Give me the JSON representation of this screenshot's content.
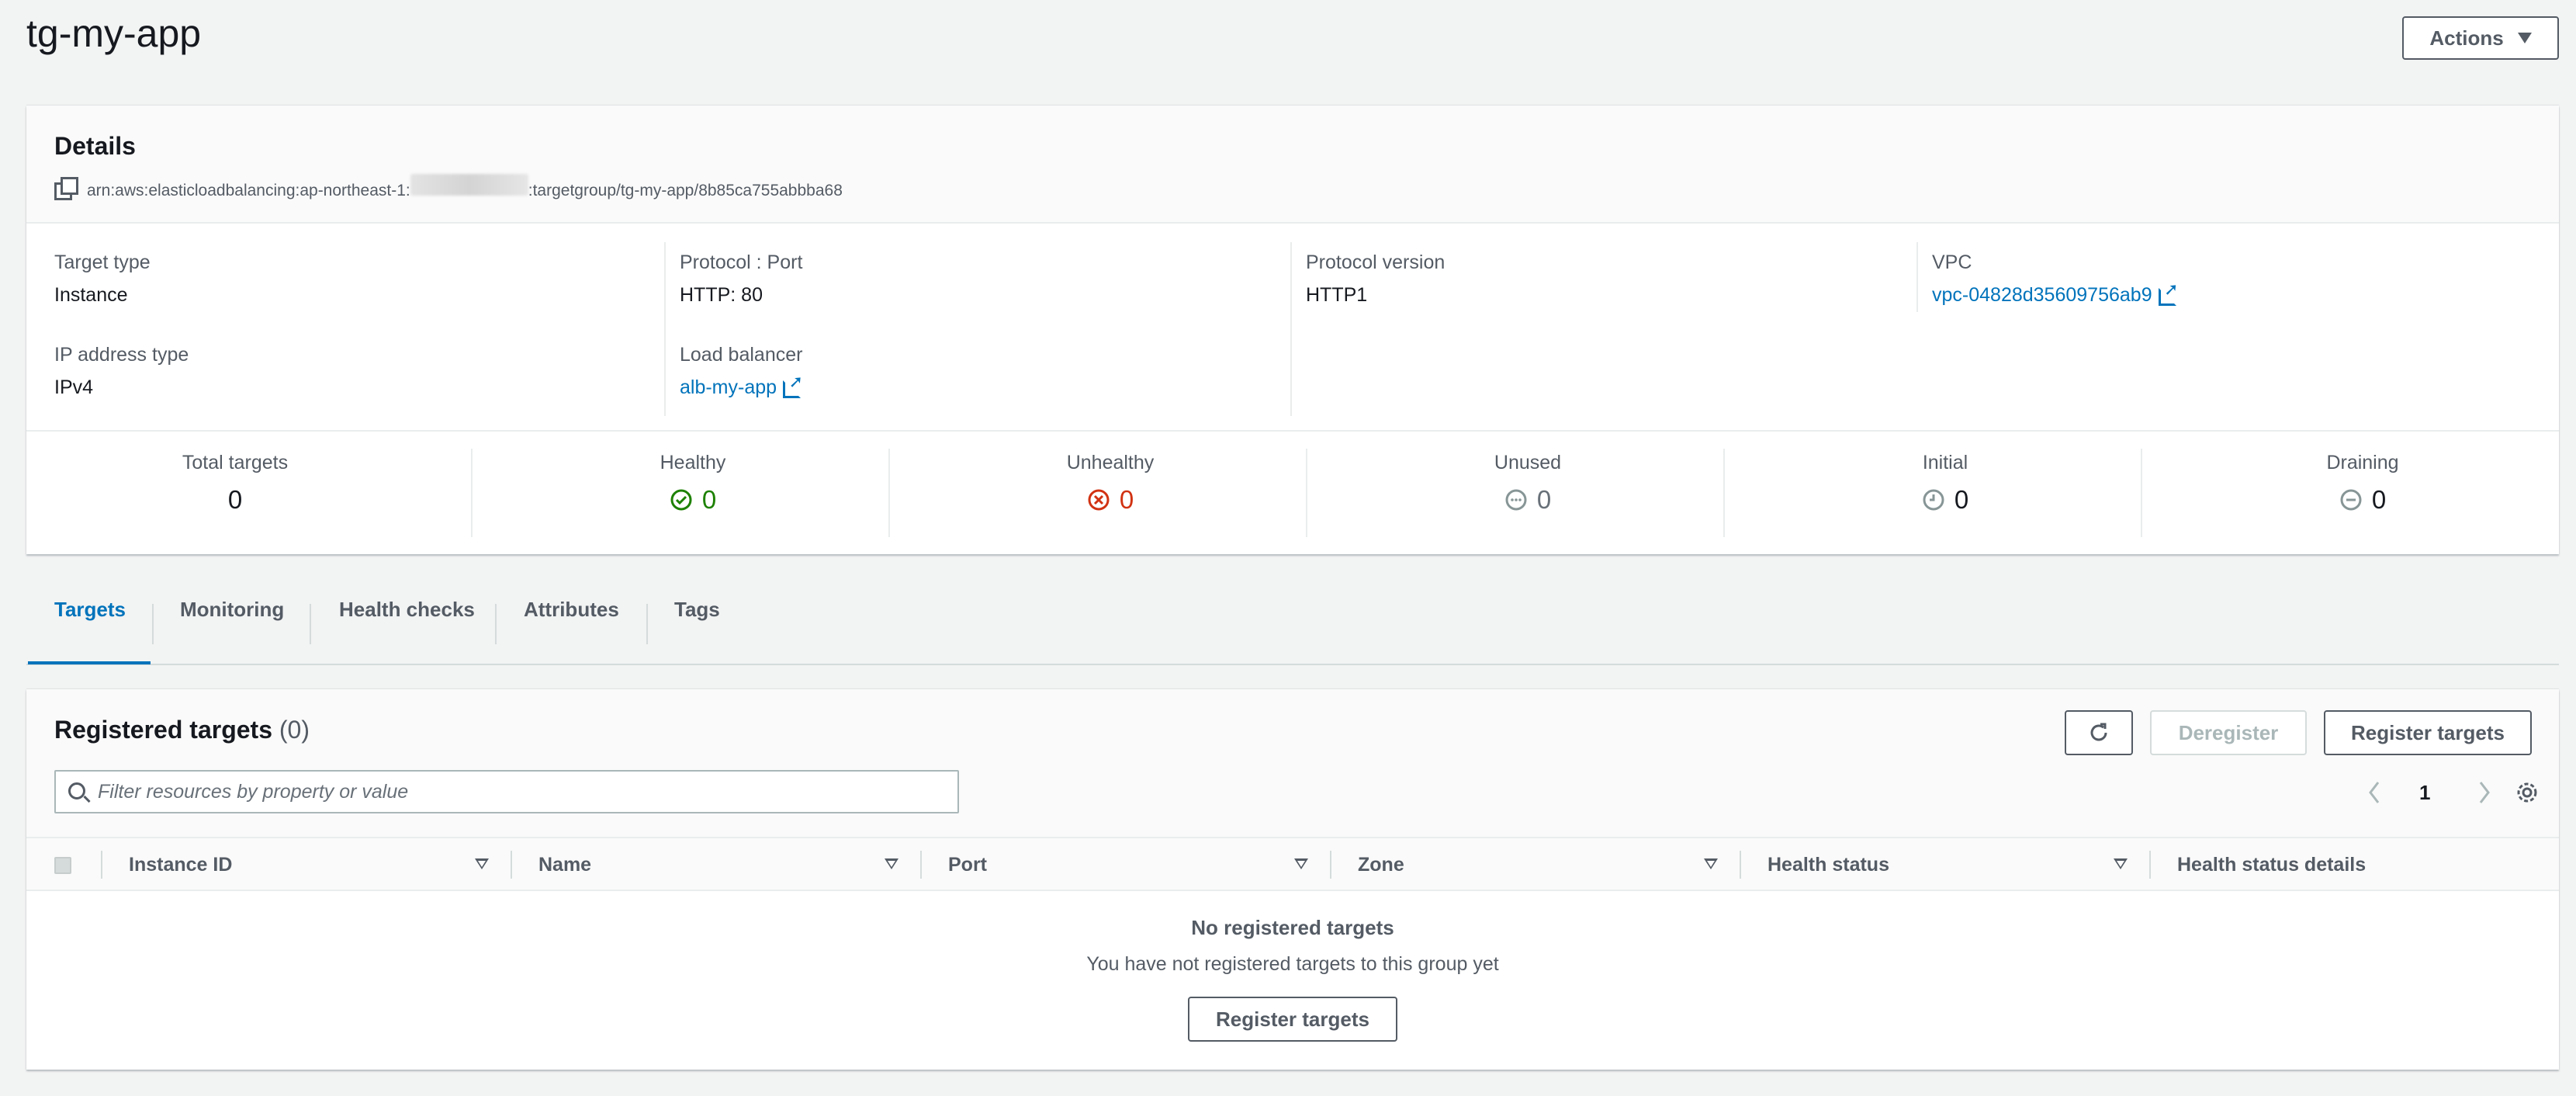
{
  "page": {
    "title": "tg-my-app",
    "actions_label": "Actions"
  },
  "details": {
    "title": "Details",
    "arn_prefix": "arn:aws:elasticloadbalancing:ap-northeast-1:",
    "arn_suffix": ":targetgroup/tg-my-app/8b85ca755abbba68",
    "fields": {
      "target_type_label": "Target type",
      "target_type": "Instance",
      "protocol_port_label": "Protocol : Port",
      "protocol_port": "HTTP: 80",
      "protocol_version_label": "Protocol version",
      "protocol_version": "HTTP1",
      "vpc_label": "VPC",
      "vpc": "vpc-04828d35609756ab9",
      "ip_type_label": "IP address type",
      "ip_type": "IPv4",
      "lb_label": "Load balancer",
      "lb": "alb-my-app"
    },
    "stats": [
      {
        "label": "Total targets",
        "value": "0",
        "icon": "",
        "color": "#16191f"
      },
      {
        "label": "Healthy",
        "value": "0",
        "icon": "check-circle-icon",
        "color": "#1d8102"
      },
      {
        "label": "Unhealthy",
        "value": "0",
        "icon": "x-circle-icon",
        "color": "#d13212"
      },
      {
        "label": "Unused",
        "value": "0",
        "icon": "ellipsis-circle-icon",
        "color": "#687078"
      },
      {
        "label": "Initial",
        "value": "0",
        "icon": "clock-circle-icon",
        "color": "#687078"
      },
      {
        "label": "Draining",
        "value": "0",
        "icon": "minus-circle-icon",
        "color": "#687078"
      }
    ]
  },
  "tabs": [
    "Targets",
    "Monitoring",
    "Health checks",
    "Attributes",
    "Tags"
  ],
  "targets": {
    "title": "Registered targets",
    "count": "(0)",
    "deregister_label": "Deregister",
    "register_label": "Register targets",
    "search_placeholder": "Filter resources by property or value",
    "page_number": "1",
    "columns": [
      "Instance ID",
      "Name",
      "Port",
      "Zone",
      "Health status",
      "Health status details"
    ],
    "empty_title": "No registered targets",
    "empty_text": "You have not registered targets to this group yet",
    "empty_button": "Register targets"
  },
  "colors": {
    "accent": "#0073bb",
    "healthy": "#1d8102",
    "unhealthy": "#d13212"
  }
}
